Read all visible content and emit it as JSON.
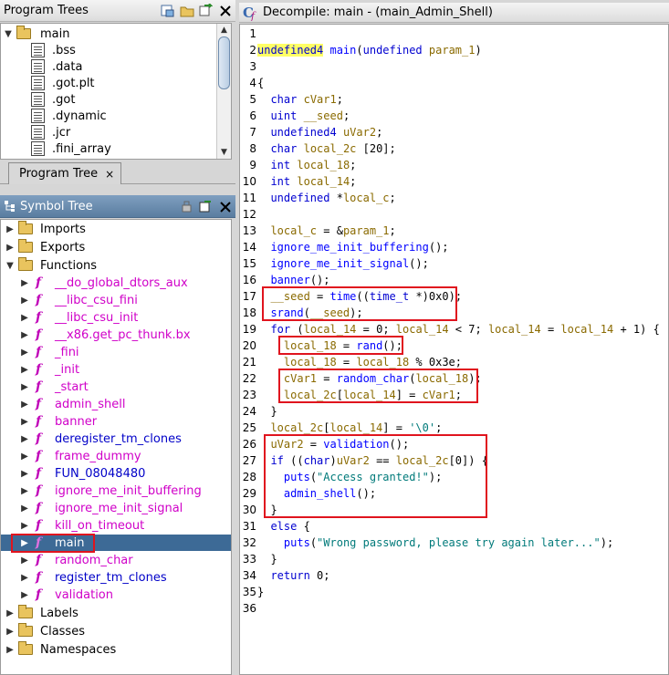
{
  "program_trees": {
    "title": "Program Trees",
    "root": "main",
    "items": [
      ".bss",
      ".data",
      ".got.plt",
      ".got",
      ".dynamic",
      ".jcr",
      ".fini_array"
    ],
    "tab_label": "Program Tree",
    "tab_close": "×"
  },
  "symbol_tree": {
    "title": "Symbol Tree",
    "imports": "Imports",
    "exports": "Exports",
    "functions": "Functions",
    "function_items": [
      "__do_global_dtors_aux",
      "__libc_csu_fini",
      "__libc_csu_init",
      "__x86.get_pc_thunk.bx",
      "_fini",
      "_init",
      "_start",
      "admin_shell",
      "banner",
      "deregister_tm_clones",
      "frame_dummy",
      "FUN_08048480",
      "ignore_me_init_buffering",
      "ignore_me_init_signal",
      "kill_on_timeout",
      "main",
      "random_char",
      "register_tm_clones",
      "validation"
    ],
    "labels": "Labels",
    "classes": "Classes",
    "namespaces": "Namespaces"
  },
  "decompiler": {
    "title": "Decompile: main -  (main_Admin_Shell)",
    "lines": [
      {
        "n": "1",
        "t": ""
      },
      {
        "n": "2",
        "t": "undefined4 main(undefined param_1)"
      },
      {
        "n": "3",
        "t": ""
      },
      {
        "n": "4",
        "t": "{"
      },
      {
        "n": "5",
        "t": "  char cVar1;"
      },
      {
        "n": "6",
        "t": "  uint __seed;"
      },
      {
        "n": "7",
        "t": "  undefined4 uVar2;"
      },
      {
        "n": "8",
        "t": "  char local_2c [20];"
      },
      {
        "n": "9",
        "t": "  int local_18;"
      },
      {
        "n": "10",
        "t": "  int local_14;"
      },
      {
        "n": "11",
        "t": "  undefined *local_c;"
      },
      {
        "n": "12",
        "t": ""
      },
      {
        "n": "13",
        "t": "  local_c = &param_1;"
      },
      {
        "n": "14",
        "t": "  ignore_me_init_buffering();"
      },
      {
        "n": "15",
        "t": "  ignore_me_init_signal();"
      },
      {
        "n": "16",
        "t": "  banner();"
      },
      {
        "n": "17",
        "t": "  __seed = time((time_t *)0x0);"
      },
      {
        "n": "18",
        "t": "  srand(__seed);"
      },
      {
        "n": "19",
        "t": "  for (local_14 = 0; local_14 < 7; local_14 = local_14 + 1) {"
      },
      {
        "n": "20",
        "t": "    local_18 = rand();"
      },
      {
        "n": "21",
        "t": "    local_18 = local_18 % 0x3e;"
      },
      {
        "n": "22",
        "t": "    cVar1 = random_char(local_18);"
      },
      {
        "n": "23",
        "t": "    local_2c[local_14] = cVar1;"
      },
      {
        "n": "24",
        "t": "  }"
      },
      {
        "n": "25",
        "t": "  local_2c[local_14] = '\\0';"
      },
      {
        "n": "26",
        "t": "  uVar2 = validation();"
      },
      {
        "n": "27",
        "t": "  if ((char)uVar2 == local_2c[0]) {"
      },
      {
        "n": "28",
        "t": "    puts(\"Access granted!\");"
      },
      {
        "n": "29",
        "t": "    admin_shell();"
      },
      {
        "n": "30",
        "t": "  }"
      },
      {
        "n": "31",
        "t": "  else {"
      },
      {
        "n": "32",
        "t": "    puts(\"Wrong password, please try again later...\");"
      },
      {
        "n": "33",
        "t": "  }"
      },
      {
        "n": "34",
        "t": "  return 0;"
      },
      {
        "n": "35",
        "t": "}"
      },
      {
        "n": "36",
        "t": ""
      }
    ]
  },
  "colors": {
    "selection": "#3d6a96",
    "function_name": "#d000c8",
    "annotation_box": "#e0141e"
  }
}
